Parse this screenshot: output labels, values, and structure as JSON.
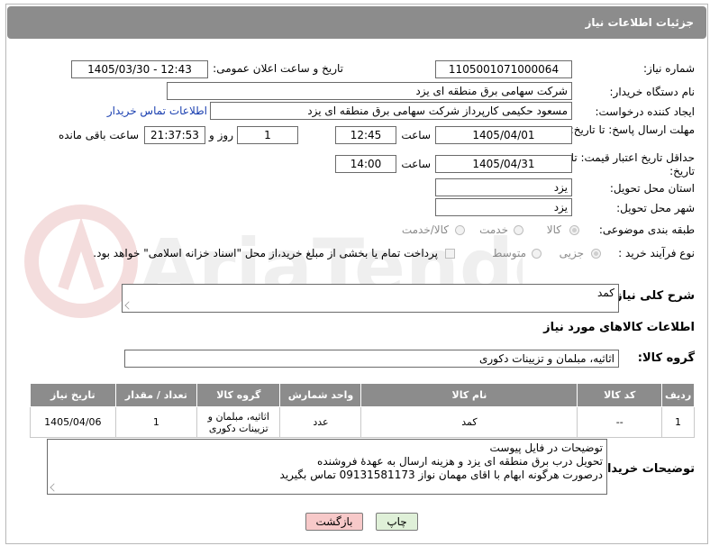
{
  "header": {
    "title": "جزئیات اطلاعات نیاز"
  },
  "form": {
    "need_number_label": "شماره نیاز:",
    "need_number": "1105001071000064",
    "announce_label": "تاریخ و ساعت اعلان عمومی:",
    "announce_value": "1405/03/30 - 12:43",
    "buyer_org_label": "نام دستگاه خریدار:",
    "buyer_org": "شرکت سهامی برق منطقه ای یزد",
    "creator_label": "ایجاد کننده درخواست:",
    "creator": "مسعود حکیمی کارپرداز شرکت سهامی برق منطقه ای یزد",
    "buyer_contact_link": "اطلاعات تماس خریدار",
    "reply_deadline_label": "مهلت ارسال پاسخ: تا تاریخ:",
    "reply_date": "1405/04/01",
    "time_word": "ساعت",
    "reply_time": "12:45",
    "days_value": "1",
    "days_word": "روز و",
    "remaining_value": "21:37:53",
    "remaining_word": "ساعت باقی مانده",
    "price_deadline_label": "حداقل تاریخ اعتبار قیمت: تا تاریخ:",
    "price_date": "1405/04/31",
    "price_time": "14:00",
    "province_label": "استان محل تحویل:",
    "province": "یزد",
    "city_label": "شهر محل تحویل:",
    "city": "یزد",
    "category_label": "طبقه بندی موضوعی:",
    "category_options": [
      "کالا",
      "خدمت",
      "کالا/خدمت"
    ],
    "purchase_type_label": "نوع فرآیند خرید :",
    "purchase_options": [
      "جزیی",
      "متوسط"
    ],
    "payment_note": "پرداخت تمام یا بخشی از مبلغ خرید،از محل \"اسناد خزانه اسلامی\" خواهد بود."
  },
  "summary": {
    "label": "شرح کلی نیاز:",
    "value": "کمد"
  },
  "goods": {
    "section_title": "اطلاعات کالاهای مورد نیاز",
    "group_label": "گروه کالا:",
    "group_value": "اثاثیه، مبلمان و تزیینات دکوری",
    "columns": [
      "ردیف",
      "کد کالا",
      "نام کالا",
      "واحد شمارش",
      "گروه کالا",
      "تعداد / مقدار",
      "تاریخ نیاز"
    ],
    "rows": [
      [
        "1",
        "--",
        "کمد",
        "عدد",
        "اثاثیه، مبلمان و تزیینات دکوری",
        "1",
        "1405/04/06"
      ]
    ]
  },
  "buyer_notes": {
    "label": "توضیحات خریدار:",
    "lines": [
      "توضیحات در فایل پیوست",
      "تحویل درب برق منطقه ای یزد و هزینه ارسال به عهدۀ فروشنده",
      "درصورت هرگونه ابهام با اقای مهمان نواز 09131581173 تماس بگیرید"
    ]
  },
  "buttons": {
    "print": "چاپ",
    "back": "بازگشت"
  },
  "watermark": {
    "text": "AriaTender.neT"
  },
  "colors": {
    "header_bg": "#8c8c8c",
    "link": "#1a3fb0",
    "back_bg": "#f7c9c9",
    "print_bg": "#dff0d8"
  }
}
